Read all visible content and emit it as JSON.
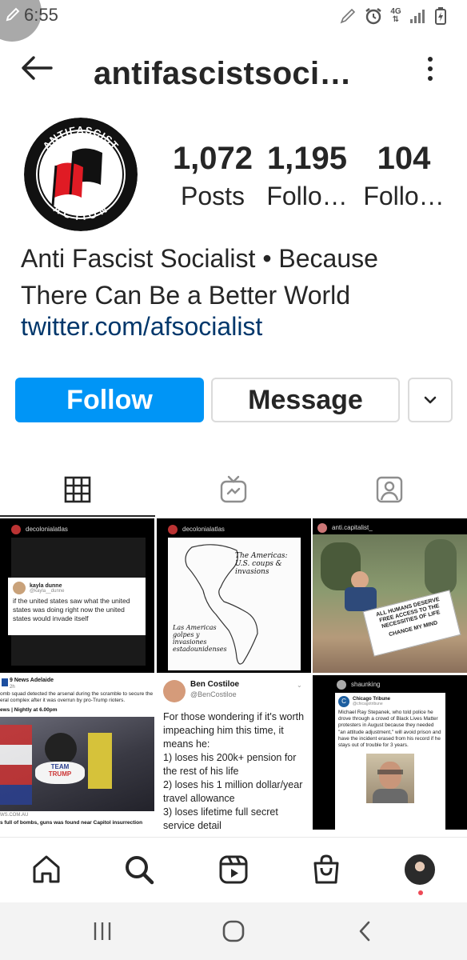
{
  "status_bar": {
    "time": "6:55",
    "network_label": "4G",
    "icons": [
      "edit-icon",
      "alarm-icon",
      "network-4g-icon",
      "signal-icon",
      "battery-charging-icon"
    ]
  },
  "header": {
    "username": "antifascistsoci…",
    "back_icon": "arrow-left-icon",
    "more_icon": "vertical-dots-icon"
  },
  "profile": {
    "avatar_text_top": "ANTIFASCIST",
    "avatar_text_bottom": "ACTION",
    "stats": [
      {
        "value": "1,072",
        "label": "Posts"
      },
      {
        "value": "1,195",
        "label": "Follo…"
      },
      {
        "value": "104",
        "label": "Follo…"
      }
    ],
    "bio_line1": "Anti Fascist Socialist • Because",
    "bio_line2": "There Can Be a Better World",
    "link": "twitter.com/afsocialist"
  },
  "actions": {
    "follow_label": "Follow",
    "message_label": "Message",
    "chevron_icon": "chevron-down-icon"
  },
  "tabs": [
    {
      "name": "grid",
      "icon": "grid-icon",
      "active": true
    },
    {
      "name": "igtv",
      "icon": "igtv-icon",
      "active": false
    },
    {
      "name": "tagged",
      "icon": "tagged-icon",
      "active": false
    }
  ],
  "posts": [
    {
      "account": "decolonialatlas",
      "tweet_name": "kayla dunne",
      "tweet_handle": "@kayla__dunne",
      "tweet_text": "if the united states saw what the united states was doing right now the united states would invade itself"
    },
    {
      "account": "decolonialatlas",
      "map_title": "The Americas: U.S. coups & invasions",
      "map_subtitle": "Las Americas golpes y invasiones estadounidenses"
    },
    {
      "account": "anti.capitalist_",
      "sign_text": "ALL HUMANS DESERVE FREE ACCESS TO THE NECESSITIES OF LIFE",
      "sign_footer": "CHANGE MY MIND"
    },
    {
      "account": "9 News Adelaide",
      "time": "2h",
      "text": "omb squad detected the arsenal during the scramble to secure the eral complex after it was overrun by pro-Trump rioters.",
      "bar": "ews | Nightly at 6.00pm",
      "hat_text_1": "TEAM",
      "hat_text_2": "TRUMP",
      "source": "WS.COM.AU",
      "caption": "s full of bombs, guns was found near Capitol insurrection"
    },
    {
      "name": "Ben Costiloe",
      "handle": "@BenCostiloe",
      "text": "For those wondering if it's worth impeaching him this time, it means he:",
      "line1": "1) loses his 200k+ pension for the rest of his life",
      "line2": "2) loses his 1 million dollar/year travel allowance",
      "line3": "3) loses lifetime full secret service detail"
    },
    {
      "account": "shaunking",
      "source": "Chicago Tribune",
      "source_handle": "@chicagotribune",
      "text": "Michael Ray Stepanek, who told police he drove through a crowd of Black Lives Matter protesters in August because they needed \"an attitude adjustment,\" will avoid prison and have the incident erased from his record if he stays out of trouble for 3 years."
    }
  ],
  "bottom_nav": [
    {
      "name": "home",
      "icon": "home-icon"
    },
    {
      "name": "search",
      "icon": "search-icon"
    },
    {
      "name": "reels",
      "icon": "reels-icon"
    },
    {
      "name": "shop",
      "icon": "shopping-bag-icon"
    },
    {
      "name": "profile",
      "icon": "profile-avatar-icon"
    }
  ],
  "android_nav": [
    {
      "name": "recents",
      "icon": "recents-icon"
    },
    {
      "name": "home",
      "icon": "home-circle-icon"
    },
    {
      "name": "back",
      "icon": "back-chevron-icon"
    }
  ],
  "colors": {
    "follow_blue": "#0095f6",
    "link_blue": "#00376b",
    "notification_red": "#ed4956"
  }
}
